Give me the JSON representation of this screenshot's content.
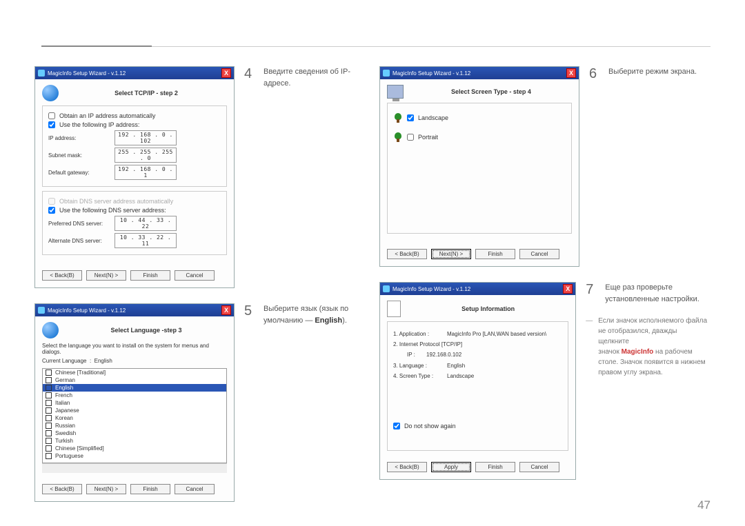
{
  "page_number": "47",
  "wizard_title": "MagicInfo Setup Wizard - v.1.12",
  "buttons": {
    "back": "< Back(B)",
    "next": "Next(N) >",
    "finish": "Finish",
    "cancel": "Cancel",
    "apply": "Apply"
  },
  "step4": {
    "num": "4",
    "text_a": "Введите сведения об IP-",
    "text_b": "адресе.",
    "heading": "Select TCP/IP - step 2",
    "chk_auto": "Obtain an IP address automatically",
    "chk_use": "Use the following IP address:",
    "lbl_ip": "IP address:",
    "val_ip": "192 . 168 .  0  . 102",
    "lbl_subnet": "Subnet mask:",
    "val_subnet": "255 . 255 . 255 .  0",
    "lbl_gw": "Default gateway:",
    "val_gw": "192 . 168 .  0  .  1",
    "chk_dns_auto": "Obtain DNS server address automatically",
    "chk_dns_use": "Use the following DNS server address:",
    "lbl_pref": "Preferred DNS server:",
    "val_pref": "10 . 44 . 33 . 22",
    "lbl_alt": "Alternate DNS server:",
    "val_alt": "10 . 33 . 22 . 11"
  },
  "step5": {
    "num": "5",
    "text_a": "Выберите язык (язык по",
    "text_b": "умолчанию — ",
    "text_bold": "English",
    "text_after": ").",
    "heading": "Select Language -step 3",
    "desc": "Select the language you want to install on the system for menus and dialogs.",
    "cur_lbl": "Current Language",
    "cur_val": "English",
    "langs": [
      "Chinese [Traditional]",
      "German",
      "English",
      "French",
      "Italian",
      "Japanese",
      "Korean",
      "Russian",
      "Swedish",
      "Turkish",
      "Chinese [Simplified]",
      "Portuguese"
    ],
    "selected_index": 2
  },
  "step6": {
    "num": "6",
    "text": "Выберите режим экрана.",
    "heading": "Select Screen Type - step 4",
    "opt_landscape": "Landscape",
    "opt_portrait": "Portrait"
  },
  "step7": {
    "num": "7",
    "text_a": "Еще раз проверьте",
    "text_b": "установленные настройки.",
    "heading": "Setup Information",
    "rows": {
      "app_k": "1. Application :",
      "app_v": "MagicInfo Pro [LAN,WAN based version\\",
      "net_k": "2. Internet Protocol [TCP/IP]",
      "ip_k": "IP :",
      "ip_v": "192.168.0.102",
      "lang_k": "3. Language :",
      "lang_v": "English",
      "scr_k": "4. Screen Type :",
      "scr_v": "Landscape"
    },
    "dont_show": "Do not show again"
  },
  "note": {
    "l1": "Если значок исполняемого файла",
    "l2": "не отобразился, дважды щелкните",
    "l3a": "значок ",
    "l3b": "MagicInfo",
    "l3c": " на рабочем",
    "l4": "столе. Значок появится в нижнем",
    "l5": "правом углу экрана."
  }
}
